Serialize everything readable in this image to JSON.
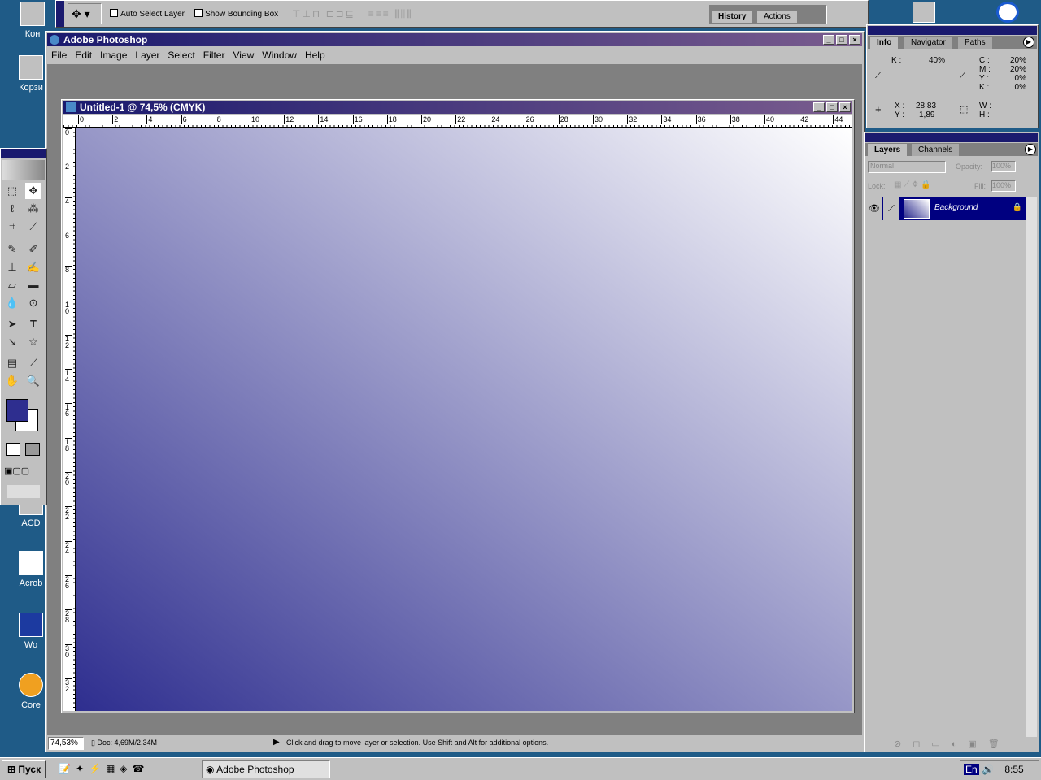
{
  "desktop": {
    "icons": [
      "Кон",
      "Корзи",
      "ACD",
      "Acrob",
      "Wo",
      "Core"
    ]
  },
  "options_bar": {
    "auto_select_layer": "Auto Select Layer",
    "show_bounding_box": "Show Bounding Box",
    "palette_tabs": [
      "History",
      "Actions"
    ]
  },
  "app": {
    "title": "Adobe Photoshop",
    "menu": [
      "File",
      "Edit",
      "Image",
      "Layer",
      "Select",
      "Filter",
      "View",
      "Window",
      "Help"
    ]
  },
  "document": {
    "title": "Untitled-1 @ 74,5% (CMYK)",
    "ruler_top": [
      "0",
      "2",
      "4",
      "6",
      "8",
      "10",
      "12",
      "14",
      "16",
      "18",
      "20",
      "22",
      "24",
      "26",
      "28",
      "30",
      "32",
      "34",
      "36",
      "38",
      "40",
      "42",
      "44"
    ],
    "ruler_left": [
      "0",
      "2",
      "4",
      "6",
      "8",
      "10",
      "12",
      "14",
      "16",
      "18",
      "20",
      "22",
      "24",
      "26",
      "28",
      "30",
      "32"
    ],
    "gradient_start": "#2e2e8f",
    "gradient_end": "#ffffff"
  },
  "status": {
    "zoom": "74,53%",
    "doc": "Doc: 4,69M/2,34M",
    "hint": "Click and drag to move layer or selection.  Use Shift and Alt for additional options."
  },
  "info_panel": {
    "tabs": [
      "Info",
      "Navigator",
      "Paths"
    ],
    "k_label": "K :",
    "k_value": "40%",
    "c": "C :",
    "c_val": "20%",
    "m": "M :",
    "m_val": "20%",
    "y": "Y :",
    "y_val": "0%",
    "kk": "K :",
    "kk_val": "0%",
    "x_label": "X :",
    "x_val": "28,83",
    "y_label": "Y :",
    "y_coord": "1,89",
    "w": "W :",
    "h": "H :"
  },
  "layers_panel": {
    "tabs": [
      "Layers",
      "Channels"
    ],
    "blend_mode": "Normal",
    "opacity_label": "Opacity:",
    "opacity": "100%",
    "lock_label": "Lock:",
    "fill_label": "Fill:",
    "fill": "100%",
    "layer_name": "Background"
  },
  "colors": {
    "foreground": "#2e2e8f",
    "background": "#ffffff"
  },
  "taskbar": {
    "start": "Пуск",
    "task": "Adobe Photoshop",
    "lang": "En",
    "clock": "8:55"
  }
}
